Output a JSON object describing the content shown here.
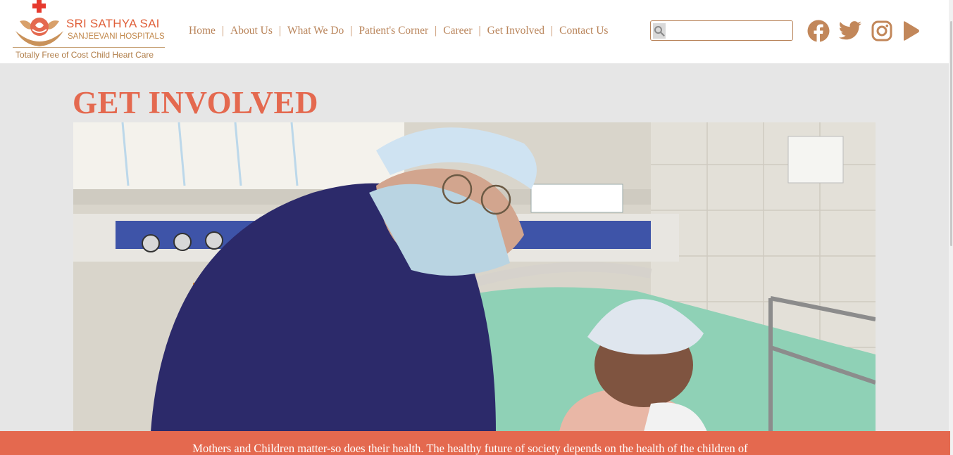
{
  "brand": {
    "name_line1": "SRI SATHYA SAI",
    "name_line2": "SANJEEVANI HOSPITALS",
    "tagline": "Totally Free of Cost Child Heart Care",
    "accent_color": "#e4694f",
    "gold_color": "#b9845a"
  },
  "nav": {
    "items": [
      {
        "label": "Home"
      },
      {
        "label": "About Us"
      },
      {
        "label": "What We Do"
      },
      {
        "label": "Patient's Corner"
      },
      {
        "label": "Career"
      },
      {
        "label": "Get Involved"
      },
      {
        "label": "Contact Us"
      }
    ],
    "separator": "|"
  },
  "search": {
    "icon": "search-icon",
    "placeholder": "",
    "value": ""
  },
  "social": [
    {
      "name": "facebook-icon"
    },
    {
      "name": "twitter-icon"
    },
    {
      "name": "instagram-icon"
    },
    {
      "name": "youtube-play-icon"
    }
  ],
  "main": {
    "title": "GET INVOLVED",
    "banner_text": "Mothers and Children matter-so does their health. The healthy future of society depends on the health of the children of"
  }
}
